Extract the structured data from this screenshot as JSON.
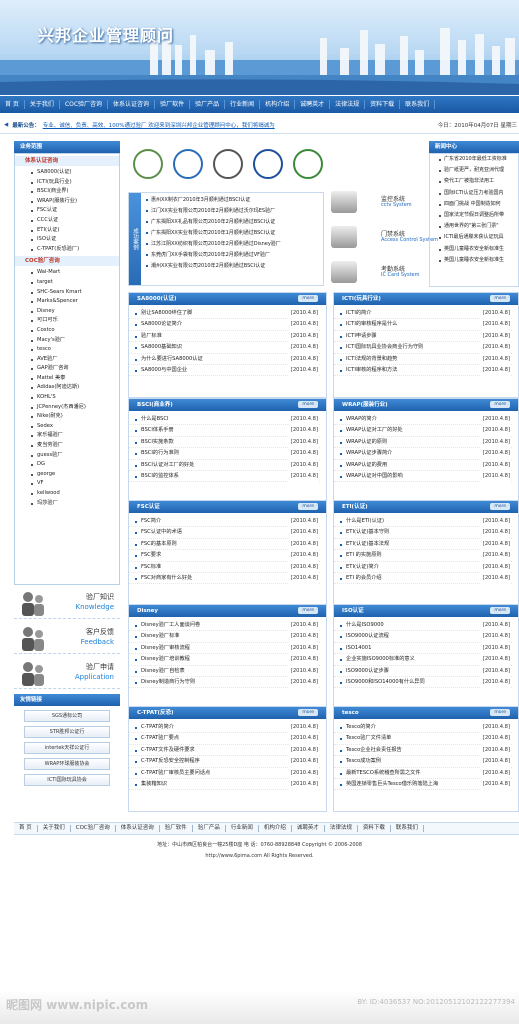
{
  "header": {
    "logo": "兴邦企业管理顾问"
  },
  "nav": [
    "首 页",
    "关于我们",
    "COC验厂咨询",
    "体系认证咨询",
    "验厂软件",
    "验厂产品",
    "行业新闻",
    "机构介绍",
    "诚聘英才",
    "法律法规",
    "资料下载",
    "联系我们"
  ],
  "notice": {
    "label": "最新公告：",
    "text": "专业、诚信、负责、高效、100%通过验厂 欢迎来到深圳兴邦企业管理顾问中心，我们将竭诚为",
    "date": "今日：2010年04月07日 星期三"
  },
  "sidebar": {
    "business_title": "业务范围",
    "cert_sub": "体系认证咨询",
    "cert_items": [
      "SA8000(认证)",
      "ICTI(玩具行业)",
      "BSCI(商业界)",
      "WRAP(服装行业)",
      "FSC认证",
      "CCC认证",
      "ETI(认证)",
      "ISO认证",
      "C-TPAT(反恐验厂)"
    ],
    "coc_sub": "COC验厂咨询",
    "coc_items": [
      "Wal-Mart",
      "target",
      "SHC-Sears Kmart",
      "Marks&Spencer",
      "Disney",
      "可口可乐",
      "Costco",
      "Macy's验厂",
      "tesco",
      "AVE验厂",
      "GAP验厂咨询",
      "Mattel 美泰",
      "Adidas(阿迪达斯)",
      "KOHL'S",
      "JCPenney(杰西潘尼)",
      "Nike(耐克)",
      "Sedex",
      "家乐福验厂",
      "麦当劳验厂",
      "guess验厂",
      "DG",
      "george",
      "VF",
      "kellwood",
      "玛莎验厂"
    ],
    "promo": [
      {
        "t1": "验厂知识",
        "t2": "Knowledge"
      },
      {
        "t1": "客户反馈",
        "t2": "Feedback"
      },
      {
        "t1": "验厂申请",
        "t2": "Application"
      }
    ],
    "links_title": "友情链接",
    "links": [
      "SGS通标公司",
      "STR胜邦公证行",
      "intertek天祥公证行",
      "WRAP环球服装协会",
      "ICTI国际玩具协会"
    ]
  },
  "certs": [
    "中国国家认证认可",
    "CNAS",
    "UKAS",
    "CQC",
    "CCEMS"
  ],
  "cases": {
    "side": "成功案例",
    "items": [
      "惠州XX制衣厂2010年3月顺利通过BSCI认证",
      "江门XX实业有限公司2010年2月顺利通过沃尔玛ES验厂",
      "广东揭阳XX礼品有限公司2010年2月顺利通过BSCI认证",
      "广东揭阳XX实业有限公司2010年1月顺利通过BSCI认证",
      "江苏江阴XX纺织有限公司2010年2月顺利通过Disney验厂",
      "东莞虎门XX手袋有限公司2010年2月顺利通过VF验厂",
      "潮州XX实业有限公司2010年2月顺利通过BSCI认证"
    ]
  },
  "products": [
    {
      "name": "监控系统",
      "en": "cctv System"
    },
    {
      "name": "门禁系统",
      "en": "Access Control System"
    },
    {
      "name": "考勤系统",
      "en": "IC Card System"
    }
  ],
  "news": {
    "title": "新闻中心",
    "items": [
      "广东省2010年最低工资标准",
      "验厂纸更严，耐克亚洲代理",
      "奕代工厂被指非法用工",
      "国际ICTI认证压力考验国内",
      "四面门挑战 中国制造如何",
      "国家法定节假日调整后所带",
      "通用世界的\"第三张门票\"",
      "ICTI最后通牒未获认证玩具",
      "英国儿童睡衣安全新标准生",
      "英国儿童睡衣安全新标准生"
    ]
  },
  "panels": [
    {
      "title": "SA8000(认证)",
      "items": [
        "别让SA8000绊住了脚",
        "SA8000论证简介",
        "验厂标准",
        "SA8000基础知识",
        "为什么要进行SA8000认证",
        "SA8000与中国企业"
      ],
      "date": "[2010.4.8]"
    },
    {
      "title": "ICTI(玩具行业)",
      "items": [
        "ICTI的简介",
        "ICTI的审核程序是什么",
        "ICTI申请步骤",
        "ICTI国际玩具业协会商业行为守则",
        "ICTI法规的背景和趋势",
        "ICTI审核的程序和方法"
      ],
      "date": "[2010.4.8]"
    },
    {
      "title": "BSCI(商业界)",
      "items": [
        "什么是BSCI",
        "BSCI体系手册",
        "BSCI实施条款",
        "BSCI的行为准则",
        "BSCI认证对工厂的好处",
        "BSCI的监控体系"
      ],
      "date": "[2010.4.8]"
    },
    {
      "title": "WRAP(服装行业)",
      "items": [
        "WRAP的简介",
        "WRAP认证对工厂的好处",
        "WRAP认证的原则",
        "WRAP认证步骤简介",
        "WRAP认证的费用",
        "WRAP认证对中国的影响"
      ],
      "date": "[2010.4.8]"
    },
    {
      "title": "FSC认证",
      "items": [
        "FSC简介",
        "FSC认证中的术语",
        "FSC的基本原则",
        "FSC要求",
        "FSC标准",
        "FSC对商家有什么好处"
      ],
      "date": "[2010.4.8]"
    },
    {
      "title": "ETI(认证)",
      "items": [
        "什么是ETI(认证)",
        "ETI(认证)基本守则",
        "ETI(认证)基本法规",
        "ETI 的实施原则",
        "ETI(认证)简介",
        "ETI 的会员介绍"
      ],
      "date": "[2010.4.8]"
    },
    {
      "title": "Disney",
      "items": [
        "Disney验厂工人面谈问卷",
        "Disney验厂标准",
        "Disney验厂审核流程",
        "Disney验厂培训教程",
        "Disney验厂自检表",
        "Disney制造商行为守则"
      ],
      "date": "[2010.4.8]"
    },
    {
      "title": "ISO认证",
      "items": [
        "什么是ISO9000",
        "ISO9000认证流程",
        "ISO14001",
        "企业实施ISO9000标准的意义",
        "ISO9000认证步骤",
        "ISO9000和ISO14000有什么异同"
      ],
      "date": "[2010.4.8]"
    },
    {
      "title": "C-TPAT(反恐)",
      "items": [
        "C-TPAT的简介",
        "C-TPAT验厂要点",
        "C-TPAT文件及硬件要求",
        "C-TPAT反恐安全控制程序",
        "C-TPAT验厂审核员主要问话点",
        "集装箱知识"
      ],
      "date": "[2010.4.8]"
    },
    {
      "title": "tesco",
      "items": [
        "Tesco的简介",
        "Tesco验厂文件清单",
        "Tesco企业社会责任报告",
        "Tesco成功案例",
        "最新TESCO系统稽查所需之文件",
        "英国连锁零售巨头Tesco借乐购落陆上海"
      ],
      "date": "[2010.4.8]"
    }
  ],
  "more": "more",
  "footer": {
    "nav": [
      "首 页",
      "关于我们",
      "COC验厂咨询",
      "体系认证咨询",
      "验厂软件",
      "验厂产品",
      "行业新闻",
      "机构介绍",
      "诚聘英才",
      "法律法规",
      "资料下载",
      "联系我们"
    ],
    "address": "地址：中山市西区柏良台一幢25楼D座 电 话：0760-88928848 Copyright © 2006-2008",
    "copyright": "http://www.6pima.com  All Rights Reserved."
  },
  "watermark": {
    "site": "昵图网 www.nipic.com",
    "id": "ID:4036537 NO:20120512102122277394",
    "by": "BY:"
  },
  "colors": {
    "accent": "#1f62ae",
    "link": "#0a58b6",
    "highlight": "#c0392b"
  }
}
